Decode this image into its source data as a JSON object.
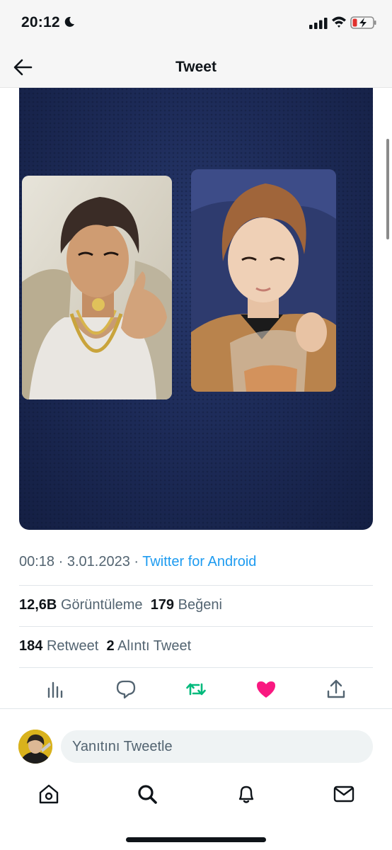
{
  "status_bar": {
    "time": "20:12"
  },
  "header": {
    "title": "Tweet"
  },
  "tweet": {
    "time": "00:18",
    "date": "3.01.2023",
    "separator": " · ",
    "source": "Twitter for Android",
    "views_count": "12,6B",
    "views_label": "Görüntüleme",
    "likes_count": "179",
    "likes_label": "Beğeni",
    "retweets_count": "184",
    "retweets_label": "Retweet",
    "quotes_count": "2",
    "quotes_label": "Alıntı Tweet"
  },
  "reply": {
    "placeholder": "Yanıtını Tweetle"
  },
  "colors": {
    "accent": "#1d9bf0",
    "retweet": "#00ba7c",
    "like": "#f91880",
    "text": "#0f1419",
    "secondary": "#536471"
  },
  "icons": [
    "moon-icon",
    "signal-icon",
    "wifi-icon",
    "battery-icon",
    "back-arrow-icon",
    "analytics-icon",
    "reply-icon",
    "retweet-icon",
    "like-icon",
    "share-icon",
    "home-icon",
    "search-icon",
    "notifications-icon",
    "messages-icon"
  ]
}
